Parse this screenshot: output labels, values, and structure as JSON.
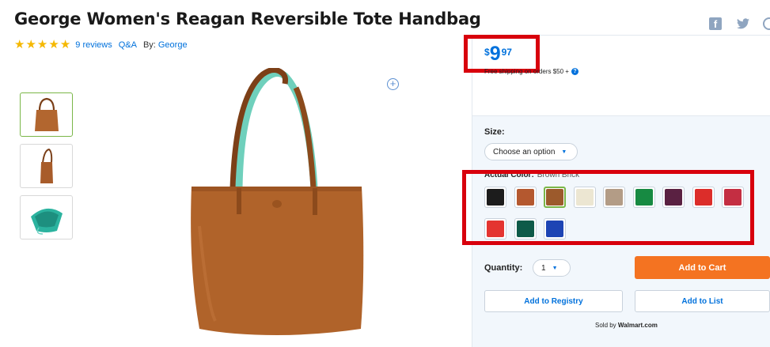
{
  "product": {
    "title": "George Women's Reagan Reversible Tote Handbag",
    "rating": 5,
    "reviews_link": "9 reviews",
    "qa_link": "Q&A",
    "by_label": "By:",
    "brand_link": "George"
  },
  "share": {
    "facebook": "f",
    "twitter": "t",
    "pinterest": "p"
  },
  "zoom_icon": "plus",
  "price": {
    "currency": "$",
    "dollars": "9",
    "cents": "97"
  },
  "shipping": {
    "text": "Free shipping on orders $50 +"
  },
  "size": {
    "label": "Size:",
    "placeholder": "Choose an option"
  },
  "color": {
    "label": "Actual Color:",
    "value": "Brown Brick",
    "swatches": [
      {
        "hex": "#1c1c1c"
      },
      {
        "hex": "#b4582f"
      },
      {
        "hex": "#9c5a2c",
        "selected": true
      },
      {
        "hex": "#ece6d2"
      },
      {
        "hex": "#b39c86"
      },
      {
        "hex": "#178a42"
      },
      {
        "hex": "#5a2142"
      },
      {
        "hex": "#dc2d2a"
      },
      {
        "hex": "#c42e42"
      },
      {
        "hex": "#e43430"
      },
      {
        "hex": "#0d5a48"
      },
      {
        "hex": "#1d44b4"
      }
    ]
  },
  "quantity": {
    "label": "Quantity:",
    "value": "1"
  },
  "buttons": {
    "add_to_cart": "Add to Cart",
    "add_to_registry": "Add to Registry",
    "add_to_list": "Add to List"
  },
  "seller": {
    "prefix": "Sold by",
    "name": "Walmart.com"
  },
  "colors": {
    "accent": "#0071dc",
    "cart": "#f47321",
    "highlight": "#d8000c",
    "star": "#f5b800"
  }
}
